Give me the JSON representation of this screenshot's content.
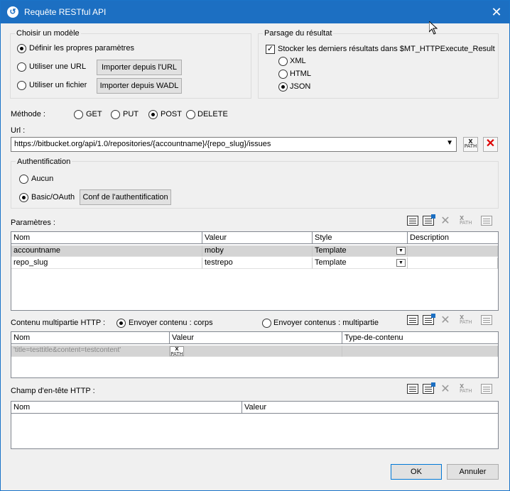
{
  "title": "Requête RESTful API",
  "model_group": {
    "title": "Choisir un modèle",
    "options": [
      "Définir les propres paramètres",
      "Utiliser une URL",
      "Utiliser un fichier"
    ],
    "selected": 0,
    "import_url_btn": "Importer depuis l'URL",
    "import_wadl_btn": "Importer depuis WADL"
  },
  "parse_group": {
    "title": "Parsage du résultat",
    "store_label": "Stocker les derniers résultats dans $MT_HTTPExecute_Result",
    "store_checked": true,
    "formats": [
      "XML",
      "HTML",
      "JSON"
    ],
    "selected": 2
  },
  "method": {
    "label": "Méthode :",
    "options": [
      "GET",
      "PUT",
      "POST",
      "DELETE"
    ],
    "selected": 2
  },
  "url": {
    "label": "Url :",
    "value": "https://bitbucket.org/api/1.0/repositories/{accountname}/{repo_slug}/issues"
  },
  "auth": {
    "title": "Authentification",
    "options": [
      "Aucun",
      "Basic/OAuth"
    ],
    "selected": 1,
    "conf_btn": "Conf de l'authentification"
  },
  "params": {
    "label": "Paramètres :",
    "columns": [
      "Nom",
      "Valeur",
      "Style",
      "Description"
    ],
    "rows": [
      [
        "accountname",
        "moby",
        "Template",
        ""
      ],
      [
        "repo_slug",
        "testrepo",
        "Template",
        ""
      ]
    ]
  },
  "multipart": {
    "label": "Contenu multipartie HTTP :",
    "options": [
      "Envoyer contenu : corps",
      "Envoyer contenus : multipartie"
    ],
    "selected": 0,
    "columns": [
      "Nom",
      "Valeur",
      "Type-de-contenu"
    ],
    "rows": [
      [
        "'title=testtitle&content=testcontent'",
        "",
        ""
      ]
    ]
  },
  "headers": {
    "label": "Champ d'en-tête HTTP :",
    "columns": [
      "Nom",
      "Valeur"
    ]
  },
  "buttons": {
    "ok": "OK",
    "cancel": "Annuler"
  },
  "icons": {
    "xpath_top": "X",
    "xpath_bottom": "PATH",
    "delete": "✕",
    "clear": "✕",
    "app": "↺",
    "close": "✕"
  }
}
